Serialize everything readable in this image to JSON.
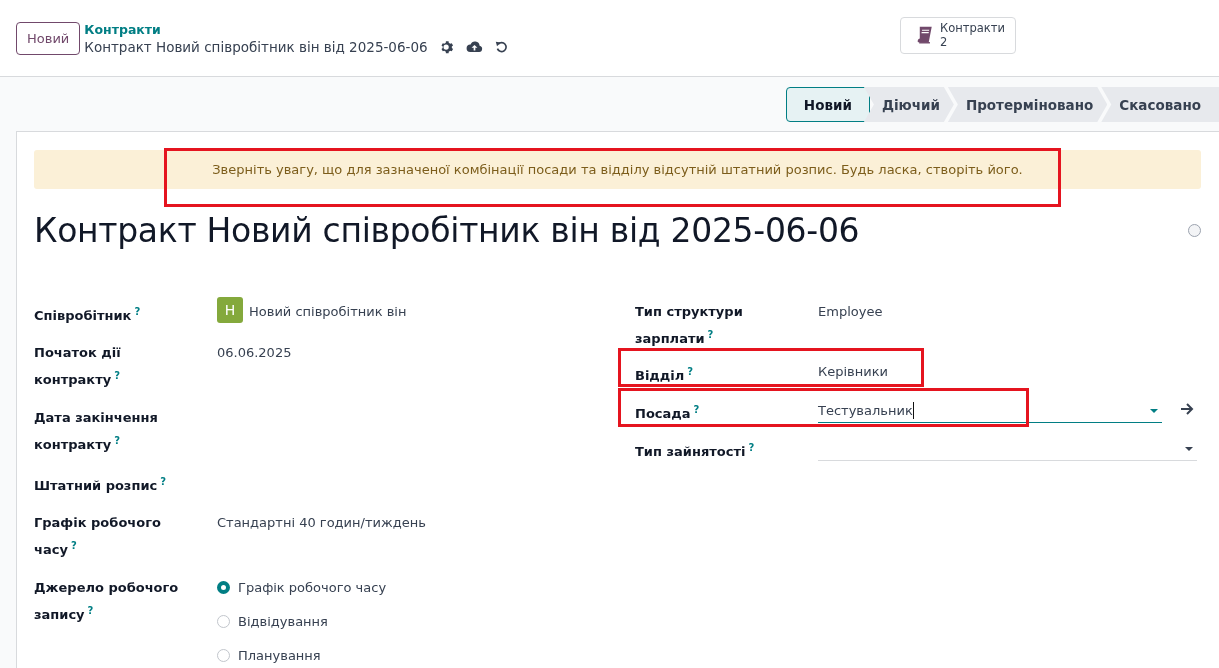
{
  "control_panel": {
    "new_button": "Новий",
    "breadcrumb": "Контракти",
    "record_title": "Контракт Новий співробітник він від 2025-06-06",
    "smart_button": {
      "label": "Контракти",
      "count": "2"
    }
  },
  "status_bar": [
    {
      "label": "Новий",
      "selected": true
    },
    {
      "label": "Діючий",
      "selected": false
    },
    {
      "label": "Протерміновано",
      "selected": false
    },
    {
      "label": "Скасовано",
      "selected": false
    }
  ],
  "alert": {
    "text": "Зверніть увагу, що для зазначеної комбінації посади та відділу відсутній штатний розпис. Будь ласка, створіть його.",
    "highlighted": true
  },
  "title": "Контракт Новий співробітник він від 2025-06-06",
  "left_fields": [
    {
      "kind": "avatar",
      "label": "Співробітник",
      "help": "?",
      "avatar": "Н",
      "value": "Новий співробітник він"
    },
    {
      "kind": "text",
      "label": "Початок дії контракту",
      "help": "?",
      "value": "06.06.2025"
    },
    {
      "kind": "text",
      "label": "Дата закінчення контракту",
      "help": "?"
    },
    {
      "kind": "text",
      "label": "Штатний розпис",
      "help": "?"
    },
    {
      "kind": "text",
      "label": "Графік робочого часу",
      "help": "?",
      "value": "Стандартні 40 годин/тиждень"
    },
    {
      "kind": "radio",
      "label": "Джерело робочого запису",
      "help": "?",
      "options": [
        {
          "label": "Графік робочого часу",
          "selected": true
        },
        {
          "label": "Відвідування",
          "selected": false
        },
        {
          "label": "Планування",
          "selected": false
        }
      ]
    }
  ],
  "right_fields": [
    {
      "kind": "text",
      "label": "Тип структури зарплати",
      "help": "?",
      "value": "Employee",
      "highlighted": false
    },
    {
      "kind": "text",
      "label": "Відділ",
      "help": "?",
      "value": "Керівники",
      "highlighted": true
    },
    {
      "kind": "select",
      "label": "Посада",
      "help": "?",
      "value": "Тестувальник",
      "focused": true,
      "link": true,
      "highlighted": true
    },
    {
      "kind": "select",
      "label": "Тип зайнятості",
      "help": "?",
      "focused": false,
      "link": false,
      "highlighted": false
    }
  ]
}
